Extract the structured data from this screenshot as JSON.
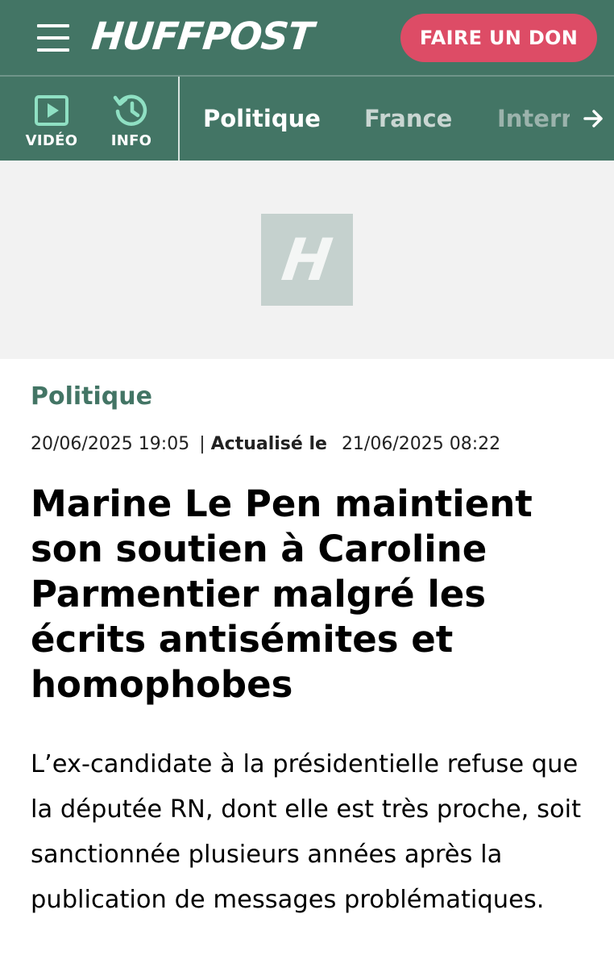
{
  "header": {
    "logo_text": "HUFFPOST",
    "donate_label": "FAIRE UN DON",
    "brand_color": "#437565",
    "donate_color": "#dd4c66"
  },
  "quick_nav": [
    {
      "label": "VIDÉO",
      "icon": "play-video-icon"
    },
    {
      "label": "INFO",
      "icon": "history-clock-icon"
    }
  ],
  "nav_tabs": [
    {
      "label": "Politique"
    },
    {
      "label": "France"
    },
    {
      "label": "International"
    }
  ],
  "nav_more_icon": "arrow-right-icon",
  "hero": {
    "placeholder_letter": "H"
  },
  "article": {
    "section": "Politique",
    "published": "20/06/2025 19:05",
    "separator": "|",
    "updated_label": "Actualisé le",
    "updated": "21/06/2025 08:22",
    "headline": "Marine Le Pen maintient son soutien à Caroline Parmentier malgré les écrits antisémites et homophobes",
    "lede": "L’ex-candidate à la présidentielle refuse que la députée RN, dont elle est très proche, soit sanctionnée plusieurs années après la publication de messages problématiques."
  }
}
